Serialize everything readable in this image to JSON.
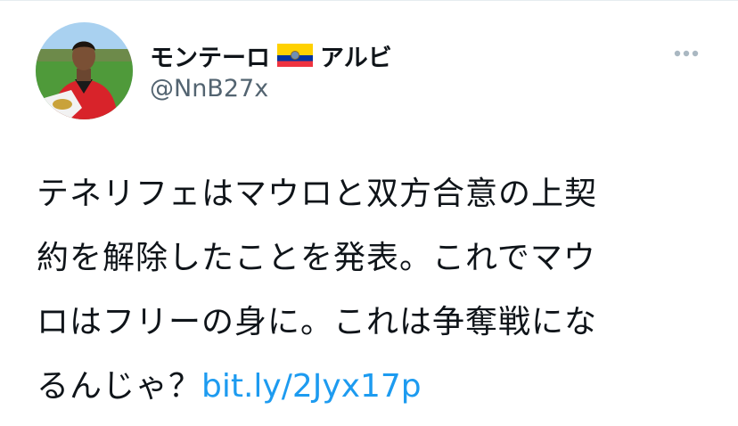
{
  "user": {
    "display_name_main": "モンテーロ",
    "flag_icon": "ecuador-flag",
    "display_name_suffix": "アルビ",
    "handle": "@NnB27x"
  },
  "tweet": {
    "lines": [
      "テネリフェはマウロと双方合意の上契",
      "約を解除したことを発表。これでマウ",
      "ロはフリーの身に。これは争奪戦にな"
    ],
    "last_line_text": "るんじゃ？",
    "link_text": "bit.ly/2Jyx17p"
  },
  "colors": {
    "text": "#0f1419",
    "secondary": "#536471",
    "link": "#1d9bf0",
    "more_dots": "#aab8c2"
  },
  "icons": {
    "more": "more-horizontal-icon",
    "avatar": "profile-photo"
  }
}
